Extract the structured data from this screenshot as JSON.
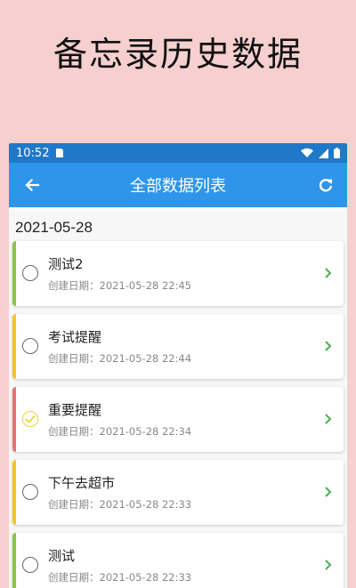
{
  "promo": {
    "title": "备忘录历史数据"
  },
  "status_bar": {
    "time": "10:52"
  },
  "app_bar": {
    "title": "全部数据列表",
    "back_icon": "arrow-left-icon",
    "refresh_icon": "refresh-icon"
  },
  "group": {
    "date": "2021-05-28"
  },
  "colors": {
    "status_bar": "#1f78c8",
    "app_bar": "#2f95ea",
    "chevron": "#4caf50",
    "page_bg": "#f6cfcf"
  },
  "items": [
    {
      "title": "测试2",
      "created": "创建日期：2021-05-28 22:45",
      "bar_color": "#8bc34a",
      "done": false
    },
    {
      "title": "考试提醒",
      "created": "创建日期：2021-05-28 22:44",
      "bar_color": "#f4c430",
      "done": false
    },
    {
      "title": "重要提醒",
      "created": "创建日期：2021-05-28 22:34",
      "bar_color": "#e57373",
      "done": true
    },
    {
      "title": "下午去超市",
      "created": "创建日期：2021-05-28 22:33",
      "bar_color": "#f4c430",
      "done": false
    },
    {
      "title": " 测试",
      "created": "创建日期：2021-05-28 22:33",
      "bar_color": "#8bc34a",
      "done": false
    }
  ]
}
